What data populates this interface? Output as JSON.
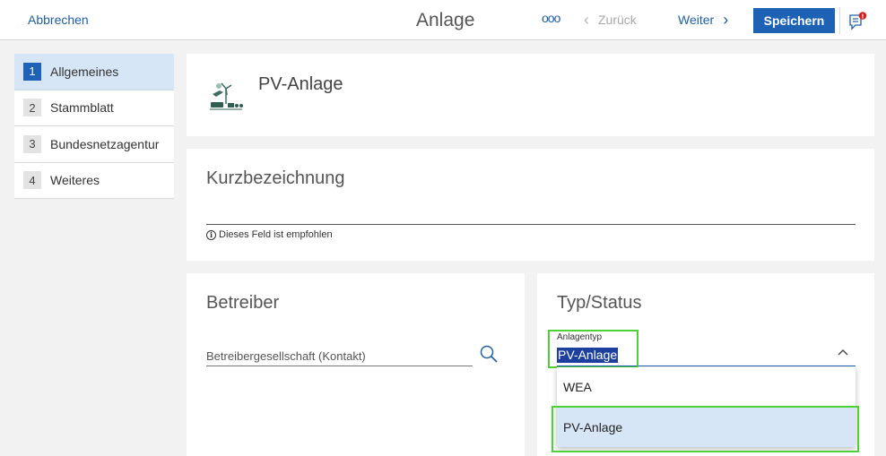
{
  "header": {
    "cancel_label": "Abbrechen",
    "title": "Anlage",
    "more_label": "ooo",
    "back_label": "Zurück",
    "next_label": "Weiter",
    "save_label": "Speichern",
    "feedback_badge": "!"
  },
  "sidebar": {
    "items": [
      {
        "num": "1",
        "label": "Allgemeines",
        "active": true
      },
      {
        "num": "2",
        "label": "Stammblatt",
        "active": false
      },
      {
        "num": "3",
        "label": "Bundesnetzagentur",
        "active": false
      },
      {
        "num": "4",
        "label": "Weiteres",
        "active": false
      }
    ]
  },
  "entity": {
    "title": "PV-Anlage",
    "icon": "pv-plant-icon"
  },
  "kurzbezeichnung": {
    "label": "Kurzbezeichnung",
    "value": "",
    "hint": "Dieses Feld ist empfohlen"
  },
  "betreiber": {
    "title": "Betreiber",
    "placeholder": "Betreibergesellschaft (Kontakt)"
  },
  "typstatus": {
    "title": "Typ/Status",
    "field_label": "Anlagentyp",
    "selected": "PV-Anlage",
    "options": [
      "WEA",
      "PV-Anlage"
    ]
  },
  "colors": {
    "accent": "#1e62b5",
    "highlight": "#4cd137",
    "selected_bg": "#d7e6f7",
    "error_badge": "#d81e1e"
  }
}
